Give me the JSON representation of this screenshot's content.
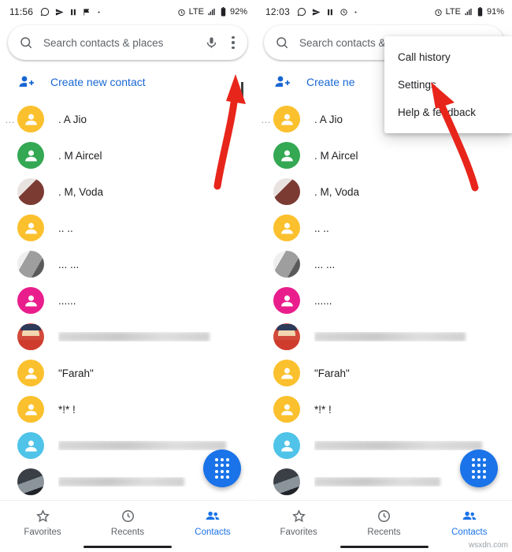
{
  "left": {
    "status": {
      "time": "11:56",
      "network": "LTE",
      "battery": "92%"
    },
    "search": {
      "placeholder": "Search contacts & places"
    },
    "create_contact_label": "Create new contact",
    "contacts": [
      {
        "name": ". A Jio",
        "blurred": false,
        "avatar": "yellow"
      },
      {
        "name": ". M Aircel",
        "blurred": false,
        "avatar": "green"
      },
      {
        "name": ". M, Voda",
        "blurred": false,
        "avatar": "photo-maroon"
      },
      {
        "name": ".. ..",
        "blurred": false,
        "avatar": "yellow"
      },
      {
        "name": "... ...",
        "blurred": false,
        "avatar": "photo-gray"
      },
      {
        "name": "......",
        "blurred": false,
        "avatar": "pink"
      },
      {
        "name": "\"Mish Na bant ★ / n i a t ll a n at l",
        "blurred": true,
        "avatar": "photo-emoji"
      },
      {
        "name": "\"Farah\"",
        "blurred": false,
        "avatar": "yellow"
      },
      {
        "name": "*!* !",
        "blurred": false,
        "avatar": "yellow"
      },
      {
        "name": "",
        "blurred": true,
        "avatar": "cyan"
      },
      {
        "name": "A... i'... nan' ggaa.a (SA...",
        "blurred": true,
        "avatar": "photo-dark"
      }
    ],
    "nav": [
      {
        "label": "Favorites",
        "icon": "star-icon",
        "active": false
      },
      {
        "label": "Recents",
        "icon": "clock-icon",
        "active": false
      },
      {
        "label": "Contacts",
        "icon": "contacts-icon",
        "active": true
      }
    ]
  },
  "right": {
    "status": {
      "time": "12:03",
      "network": "LTE",
      "battery": "91%"
    },
    "search": {
      "placeholder": "Search contacts &"
    },
    "create_contact_label": "Create ne",
    "menu": {
      "items": [
        {
          "label": "Call history"
        },
        {
          "label": "Settings"
        },
        {
          "label": "Help & feedback"
        }
      ]
    },
    "contacts": [
      {
        "name": ". A Jio",
        "blurred": false,
        "avatar": "yellow"
      },
      {
        "name": ". M Aircel",
        "blurred": false,
        "avatar": "green"
      },
      {
        "name": ". M, Voda",
        "blurred": false,
        "avatar": "photo-maroon"
      },
      {
        "name": ".. ..",
        "blurred": false,
        "avatar": "yellow"
      },
      {
        "name": "... ...",
        "blurred": false,
        "avatar": "photo-gray"
      },
      {
        "name": "......",
        "blurred": false,
        "avatar": "pink"
      },
      {
        "name": "",
        "blurred": true,
        "avatar": "photo-emoji"
      },
      {
        "name": "\"Farah\"",
        "blurred": false,
        "avatar": "yellow"
      },
      {
        "name": "*!* !",
        "blurred": false,
        "avatar": "yellow"
      },
      {
        "name": "",
        "blurred": true,
        "avatar": "cyan"
      },
      {
        "name": "bye(SA...",
        "blurred": true,
        "avatar": "photo-dark"
      }
    ],
    "nav": [
      {
        "label": "Favorites",
        "icon": "star-icon",
        "active": false
      },
      {
        "label": "Recents",
        "icon": "clock-icon",
        "active": false
      },
      {
        "label": "Contacts",
        "icon": "contacts-icon",
        "active": true
      }
    ]
  },
  "watermark": "wsxdn.com",
  "colors": {
    "accent": "#1a73e8",
    "link": "#1967d2",
    "arrow": "#e8251b",
    "muted": "#5f6368"
  }
}
